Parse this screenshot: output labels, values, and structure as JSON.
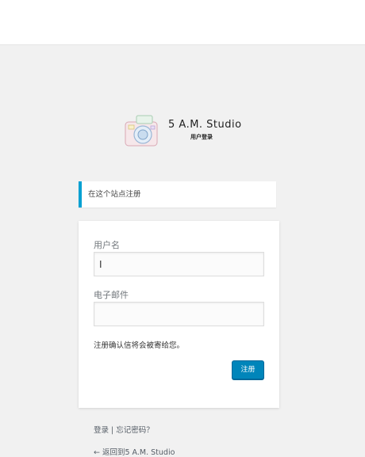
{
  "logo": {
    "title": "5  A.M.  Studio",
    "subtitle": "用户登录"
  },
  "message": {
    "text": "在这个站点注册"
  },
  "form": {
    "username_label": "用户名",
    "username_value": "",
    "email_label": "电子邮件",
    "email_value": "",
    "note": "注册确认信将会被寄给您。",
    "submit_label": "注册"
  },
  "nav": {
    "login_label": "登录",
    "separator": " | ",
    "lost_password_label": "忘记密码？"
  },
  "back": {
    "label": "← 返回到5 A.M. Studio"
  },
  "colors": {
    "background": "#f1f1f1",
    "accent": "#00a0d2",
    "button": "#0085ba"
  }
}
